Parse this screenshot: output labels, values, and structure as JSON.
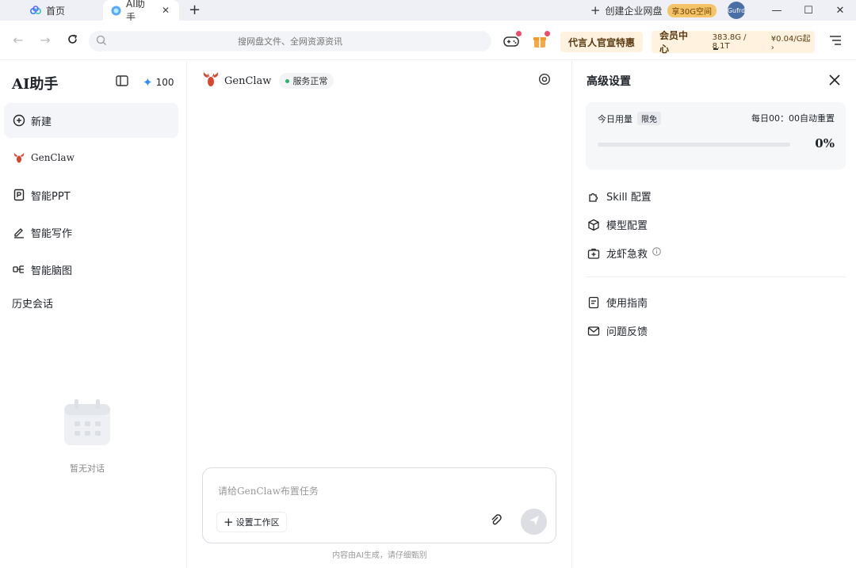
{
  "tabs": {
    "home_label": "首页",
    "active_label": "AI助手",
    "create_enterprise": "创建企业网盘",
    "space_badge": "享30G空间",
    "avatar_text": "Gufrd"
  },
  "toolbar": {
    "search_placeholder": "搜网盘文件、全网资源资讯",
    "promo_label": "代言人官宣特惠",
    "member_title": "会员中心",
    "member_storage": "383.8G / 8.1T",
    "member_price": "¥0.04/G起 ›",
    "storage_used_fraction": 0.05
  },
  "sidebar": {
    "title": "AI助手",
    "credits": "100",
    "items": [
      {
        "label": "新建",
        "icon": "plus-circle-icon"
      },
      {
        "label": "GenClaw",
        "icon": "lobster-icon"
      },
      {
        "label": "智能PPT",
        "icon": "ppt-icon"
      },
      {
        "label": "智能写作",
        "icon": "pen-icon"
      },
      {
        "label": "智能脑图",
        "icon": "mindmap-icon"
      }
    ],
    "history_label": "历史会话",
    "empty_text": "暂无对话"
  },
  "chat": {
    "agent_name": "GenClaw",
    "status": "服务正常",
    "input_placeholder": "请给GenClaw布置任务",
    "workspace_button": "设置工作区",
    "disclaimer": "内容由AI生成，请仔细甄别"
  },
  "panel": {
    "title": "高级设置",
    "usage_label": "今日用量",
    "usage_badge": "限免",
    "reset_text": "每日00：00自动重置",
    "usage_percent": "0%",
    "usage_fraction": 0,
    "items": {
      "skill": "Skill 配置",
      "model": "模型配置",
      "rescue": "龙虾急救",
      "guide": "使用指南",
      "feedback": "问题反馈"
    }
  },
  "colors": {
    "accent": "#2f8cff",
    "status_green": "#27b36a",
    "promo_bg": "#fff3df",
    "lobster": "#d9452e"
  }
}
